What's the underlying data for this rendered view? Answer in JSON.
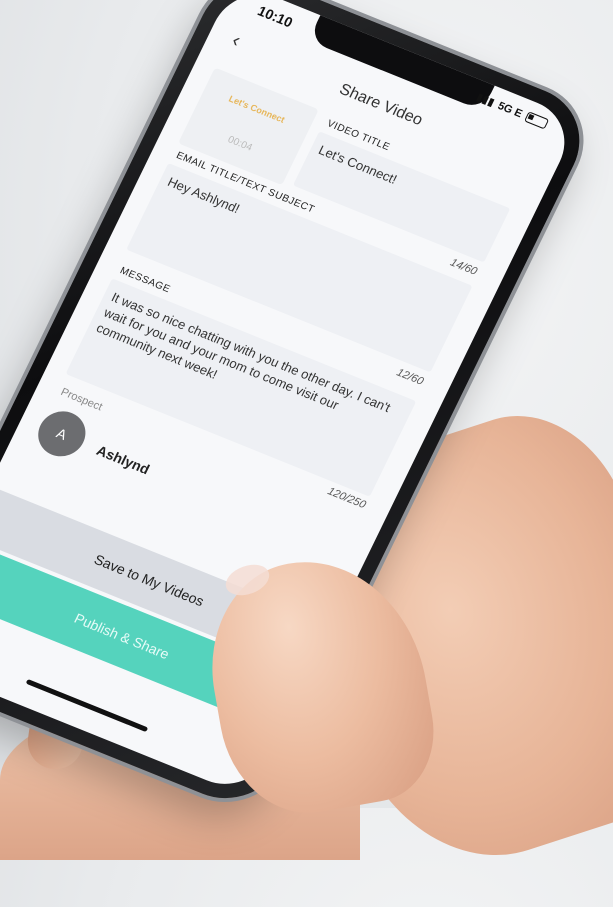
{
  "status": {
    "time": "10:10",
    "network": "5G E"
  },
  "header": {
    "title": "Share Video",
    "back_icon": "chevron-left-icon"
  },
  "thumbnail": {
    "label": "Let's Connect",
    "duration": "00:04"
  },
  "video_title": {
    "label": "VIDEO TITLE",
    "value": "Let's Connect!",
    "counter": "14/60"
  },
  "email_title": {
    "label": "EMAIL TITLE/TEXT SUBJECT",
    "value": "Hey Ashlynd!",
    "counter": "12/60"
  },
  "message": {
    "label": "MESSAGE",
    "value": "It was so nice chatting with you the other day. I can't wait for you and your mom to come visit our community next week!",
    "counter": "120/250"
  },
  "prospect": {
    "label": "Prospect",
    "initial": "A",
    "name": "Ashlynd"
  },
  "actions": {
    "save_label": "Save to My Videos",
    "publish_label": "Publish & Share"
  },
  "colors": {
    "accent_teal": "#55d3bd",
    "thumbnail_text": "#e7b75b",
    "avatar": "#6c6d70"
  }
}
